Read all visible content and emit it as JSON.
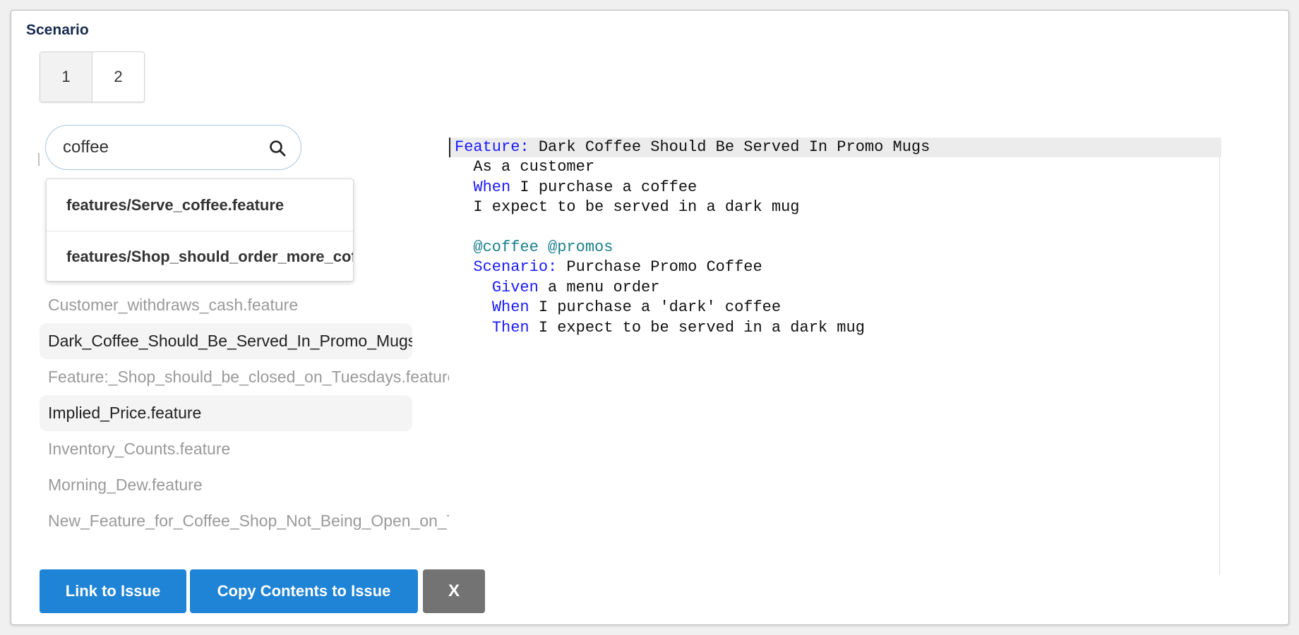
{
  "dialog": {
    "title": "Scenario"
  },
  "tabs": [
    {
      "label": "1",
      "active": true
    },
    {
      "label": "2",
      "active": false
    }
  ],
  "search": {
    "value": "coffee",
    "icon": "search-icon"
  },
  "dropdown": {
    "items": [
      "features/Serve_coffee.feature",
      "features/Shop_should_order_more_coffee.feature"
    ]
  },
  "file_list": [
    {
      "name": "Customer_withdraws_cash.feature",
      "highlighted": false
    },
    {
      "name": "Dark_Coffee_Should_Be_Served_In_Promo_Mugs.feature",
      "highlighted": true
    },
    {
      "name": "Feature:_Shop_should_be_closed_on_Tuesdays.feature",
      "highlighted": false
    },
    {
      "name": "Implied_Price.feature",
      "highlighted": true
    },
    {
      "name": "Inventory_Counts.feature",
      "highlighted": false
    },
    {
      "name": "Morning_Dew.feature",
      "highlighted": false
    },
    {
      "name": "New_Feature_for_Coffee_Shop_Not_Being_Open_on_Tuesdays.feature",
      "highlighted": false
    }
  ],
  "code": {
    "lines": [
      {
        "indent": "",
        "kw": "Feature:",
        "text": " Dark Coffee Should Be Served In Promo Mugs"
      },
      {
        "indent": "  ",
        "kw": "",
        "text": "As a customer"
      },
      {
        "indent": "  ",
        "kw": "When",
        "text": " I purchase a coffee"
      },
      {
        "indent": "  ",
        "kw": "",
        "text": "I expect to be served in a dark mug"
      },
      {
        "indent": "",
        "kw": "",
        "text": ""
      },
      {
        "indent": "  ",
        "tag": "@coffee @promos",
        "text": ""
      },
      {
        "indent": "  ",
        "kw": "Scenario:",
        "text": " Purchase Promo Coffee"
      },
      {
        "indent": "    ",
        "kw": "Given",
        "text": " a menu order"
      },
      {
        "indent": "    ",
        "kw": "When",
        "text": " I purchase a 'dark' coffee"
      },
      {
        "indent": "    ",
        "kw": "Then",
        "text": " I expect to be served in a dark mug"
      }
    ]
  },
  "footer": {
    "link_label": "Link to Issue",
    "copy_label": "Copy Contents to Issue",
    "close_label": "X"
  },
  "colors": {
    "primary_button": "#1f83d6",
    "close_button": "#737373",
    "keyword": "#1a1aff",
    "tag": "#1b7f8c"
  }
}
